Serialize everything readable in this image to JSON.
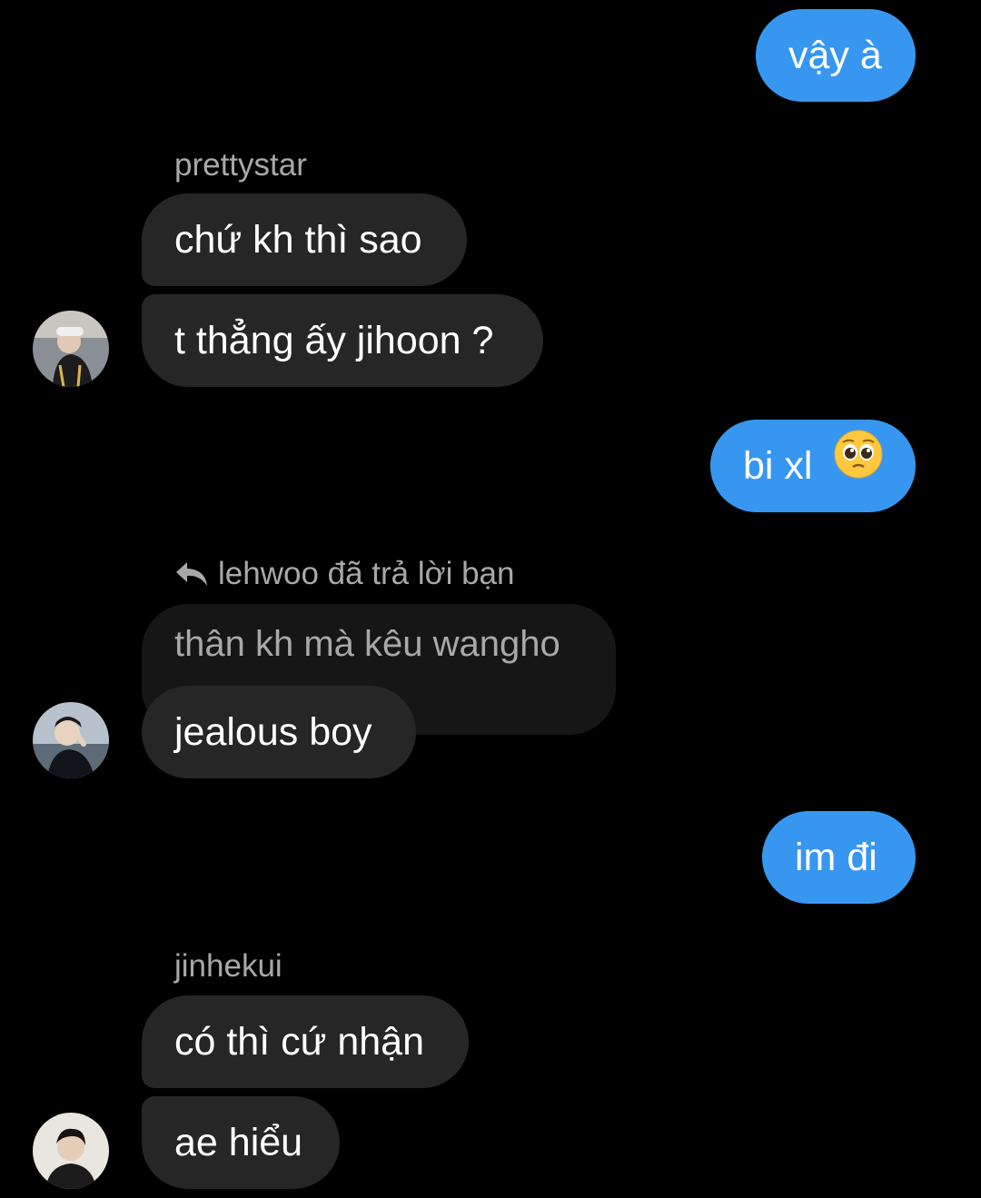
{
  "colors": {
    "background": "#000000",
    "outgoing_bubble": "#3797f0",
    "incoming_bubble": "#262626",
    "quoted_bubble": "#161616",
    "meta_text": "#a8a8a8"
  },
  "messages": {
    "out_1": "vậy à",
    "group_1": {
      "sender": "prettystar",
      "msg_1": "chứ kh thì sao",
      "msg_2": "t thẳng ấy jihoon ?"
    },
    "out_2": {
      "text": "bi xl",
      "emoji": "pleading-face-emoji"
    },
    "group_2": {
      "reply_label": "lehwoo đã trả lời bạn",
      "reply_icon": "reply-arrow-icon",
      "quoted_text": "thân kh mà kêu wangho",
      "msg_1": "jealous boy"
    },
    "out_3": "im đi",
    "group_3": {
      "sender": "jinhekui",
      "msg_1": "có thì cứ nhận",
      "msg_2": "ae hiểu"
    }
  }
}
